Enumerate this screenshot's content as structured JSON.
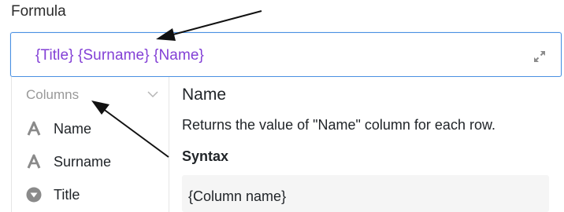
{
  "field": {
    "label": "Formula",
    "value": "{Title} {Surname} {Name}"
  },
  "icons": {
    "expand": "expand-icon",
    "chevron": "chevron-down-icon",
    "text_type": "text-type-icon",
    "single_select_type": "single-select-icon"
  },
  "columns": {
    "header": "Columns",
    "items": [
      {
        "label": "Name",
        "icon": "text-type-icon"
      },
      {
        "label": "Surname",
        "icon": "text-type-icon"
      },
      {
        "label": "Title",
        "icon": "single-select-icon"
      }
    ]
  },
  "detail": {
    "title": "Name",
    "description": "Returns the value of \"Name\" column for each row.",
    "syntax_heading": "Syntax",
    "syntax": "{Column name}"
  },
  "colors": {
    "formula_text": "#8340d6",
    "input_border": "#4a90e2",
    "muted": "#999999"
  }
}
